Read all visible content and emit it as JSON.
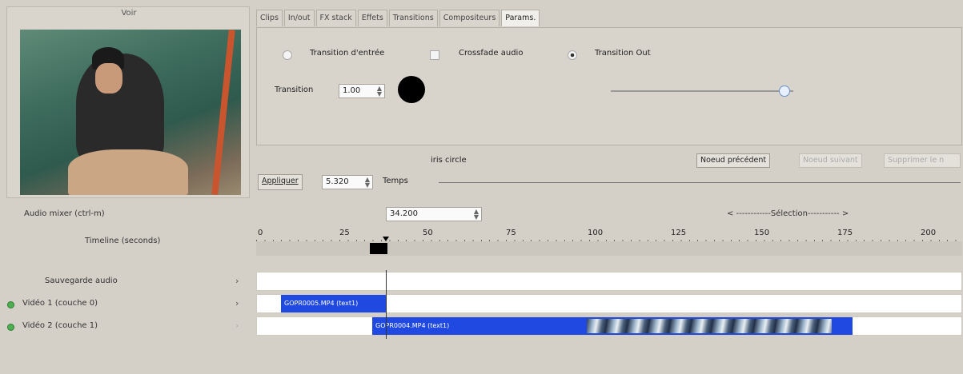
{
  "preview": {
    "title": "Voir"
  },
  "tabs": [
    "Clips",
    "In/out",
    "FX stack",
    "Effets",
    "Transitions",
    "Compositeurs",
    "Params."
  ],
  "params": {
    "radio_in": "Transition d'entrée",
    "crossfade": "Crossfade audio",
    "radio_out": "Transition Out",
    "transition_label": "Transition",
    "transition_value": "1.00",
    "effect_name": "iris circle",
    "prev_node": "Noeud précédent",
    "next_node": "Noeud suivant",
    "delete_node": "Supprimer le n",
    "apply": "Appliquer",
    "time_value": "5.320",
    "time_label": "Temps",
    "slider_level": 0.95
  },
  "timeline": {
    "audio_mixer": "Audio mixer (ctrl-m)",
    "position": "34.200",
    "selection": "< ------------Sélection----------- >",
    "axis_label": "Timeline (seconds)",
    "ticks": [
      "0",
      "25",
      "50",
      "75",
      "100",
      "125",
      "150",
      "175",
      "200"
    ],
    "tracks": [
      {
        "label": "Sauvegarde audio",
        "clip": ""
      },
      {
        "label": "Vidéo 1 (couche 0)",
        "clip": "GOPR0005.MP4 (text1)"
      },
      {
        "label": "Vidéo 2 (couche 1)",
        "clip": "GOPR0004.MP4 (text1)"
      }
    ]
  },
  "colors": {
    "clip": "#1f49e0",
    "track_eye": "#4caf50"
  }
}
